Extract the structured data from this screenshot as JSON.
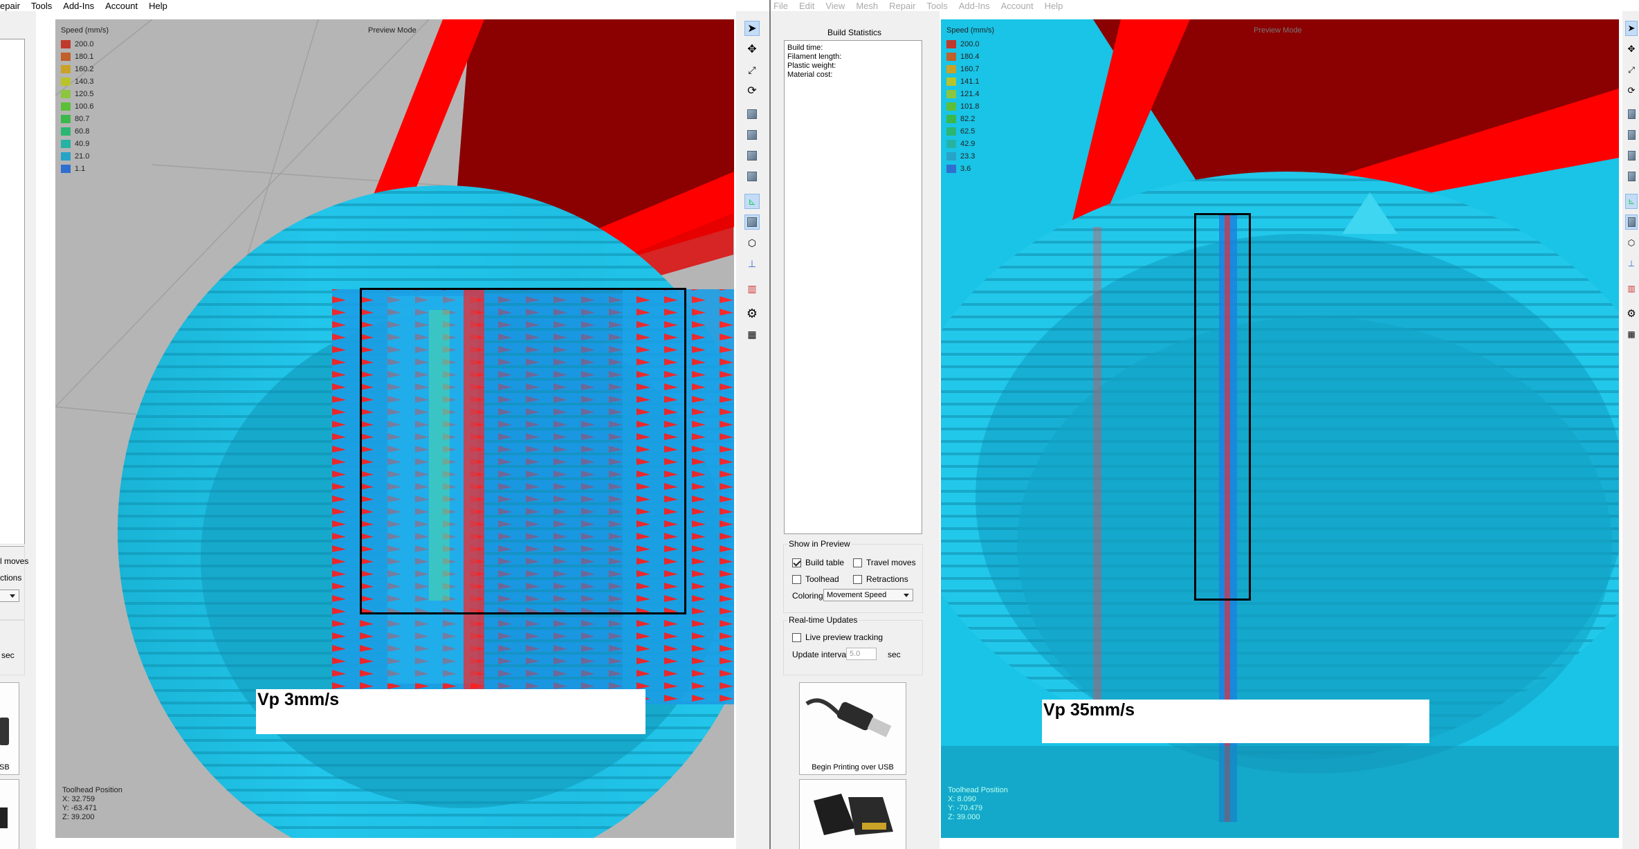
{
  "left_window": {
    "menu": [
      "epair",
      "Tools",
      "Add-Ins",
      "Account",
      "Help"
    ],
    "partial_labels": {
      "travel": "l moves",
      "retractions": "ctions",
      "sec": "sec",
      "usb": "SB"
    },
    "viewport": {
      "mode_label": "Preview Mode",
      "legend": {
        "title": "Speed (mm/s)",
        "values": [
          "200.0",
          "180.1",
          "160.2",
          "140.3",
          "120.5",
          "100.6",
          "80.7",
          "60.8",
          "40.9",
          "21.0",
          "1.1"
        ]
      },
      "toolhead": {
        "title": "Toolhead Position",
        "x": "X: 32.759",
        "y": "Y: -63.471",
        "z": "Z: 39.200"
      },
      "annotation": "Vp 3mm/s"
    }
  },
  "right_window": {
    "menu": [
      "File",
      "Edit",
      "View",
      "Mesh",
      "Repair",
      "Tools",
      "Add-Ins",
      "Account",
      "Help"
    ],
    "build_statistics": {
      "title": "Build Statistics",
      "lines": [
        "Build time:",
        "Filament length:",
        "Plastic weight:",
        "Material cost:"
      ]
    },
    "show_in_preview": {
      "title": "Show in Preview",
      "build_table": {
        "label": "Build table",
        "checked": true
      },
      "travel_moves": {
        "label": "Travel moves",
        "checked": false
      },
      "toolhead": {
        "label": "Toolhead",
        "checked": false
      },
      "retractions": {
        "label": "Retractions",
        "checked": false
      },
      "coloring_label": "Coloring",
      "coloring_value": "Movement Speed"
    },
    "realtime": {
      "title": "Real-time Updates",
      "live_preview": {
        "label": "Live preview tracking",
        "checked": false
      },
      "interval_label": "Update interval",
      "interval_value": "5.0",
      "interval_unit": "sec"
    },
    "usb_button": "Begin Printing over USB",
    "viewport": {
      "mode_label": "Preview Mode",
      "legend": {
        "title": "Speed (mm/s)",
        "values": [
          "200.0",
          "180.4",
          "160.7",
          "141.1",
          "121.4",
          "101.8",
          "82.2",
          "62.5",
          "42.9",
          "23.3",
          "3.6"
        ]
      },
      "toolhead": {
        "title": "Toolhead Position",
        "x": "X: 8.090",
        "y": "Y: -70.479",
        "z": "Z: 39.000"
      },
      "annotation": "Vp 35mm/s"
    }
  },
  "colors": {
    "legend": [
      "#c0392b",
      "#c0602a",
      "#c9a227",
      "#b8c42a",
      "#8cc63f",
      "#5cbf3a",
      "#3bb84a",
      "#2bb673",
      "#26b3a3",
      "#27a3c8",
      "#2f6fcf"
    ],
    "filament": "#1fc8e8",
    "travel": "#ff0000",
    "bed_dark": "#8b0000",
    "grid": "#a9a9a9"
  }
}
